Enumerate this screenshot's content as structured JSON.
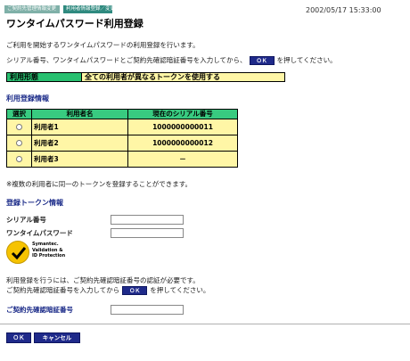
{
  "breadcrumb": {
    "items": [
      "ご契約先管理情報変更",
      "利用者情報登録／変更"
    ]
  },
  "timestamp": "2002/05/17  15:33:00",
  "page": {
    "title": "ワンタイムパスワード利用登録",
    "desc1": "ご利用を開始するワンタイムパスワードの利用登録を行います。",
    "desc2_pre": "シリアル番号、ワンタイムパスワードとご契約先確認暗証番号を入力してから、",
    "desc2_btn": "ＯＫ",
    "desc2_post": "を押してください。"
  },
  "usage": {
    "label": "利用形態",
    "value": "全ての利用者が異なるトークンを使用する"
  },
  "user_section": {
    "title": "利用登録情報",
    "columns": [
      "選択",
      "利用者名",
      "現在のシリアル番号"
    ],
    "rows": [
      {
        "name": "利用者1",
        "serial": "1000000000011"
      },
      {
        "name": "利用者2",
        "serial": "1000000000012"
      },
      {
        "name": "利用者3",
        "serial": "－"
      }
    ],
    "note": "※複数の利用者に同一のトークンを登録することができます。"
  },
  "token_section": {
    "title": "登録トークン情報",
    "serial_label": "シリアル番号",
    "otp_label": "ワンタイムパスワード",
    "serial_value": "",
    "otp_value": ""
  },
  "logo": {
    "line1": "Symantec.",
    "line2": "Validation &",
    "line3": "ID Protection"
  },
  "auth_section": {
    "text1": "利用登録を行うには、ご契約先確認暗証番号の認証が必要です。",
    "text2_pre": "ご契約先確認暗証番号を入力してから",
    "text2_btn": "ＯＫ",
    "text2_post": "を押してください。",
    "pin_label": "ご契約先確認暗証番号",
    "pin_value": ""
  },
  "buttons": {
    "ok": "ＯＫ",
    "cancel": "キャンセル"
  },
  "colors": {
    "header_green": "#38cb80",
    "row_yellow": "#fff6a6",
    "button_navy": "#1f2a8a",
    "section_title_blue": "#1a2a88"
  }
}
